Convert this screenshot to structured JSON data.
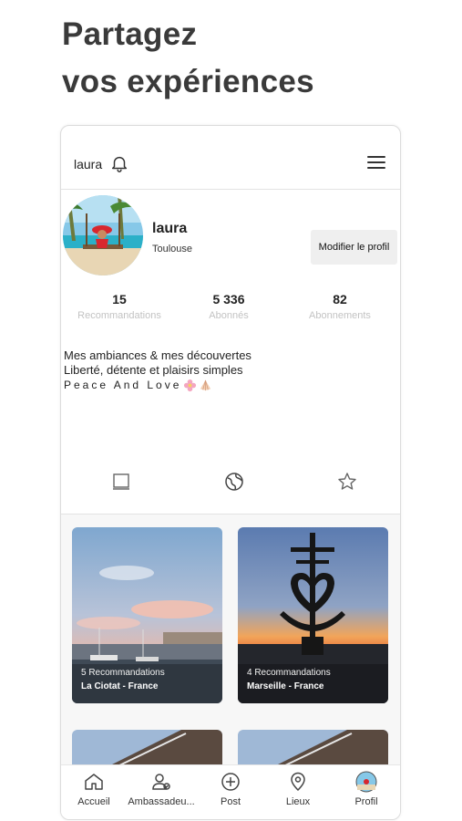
{
  "headline": {
    "line1": "Partagez",
    "line2": "vos expériences"
  },
  "topbar": {
    "username": "laura"
  },
  "profile": {
    "name": "laura",
    "city": "Toulouse",
    "edit_label": "Modifier le profil"
  },
  "stats": [
    {
      "value": "15",
      "label": "Recommandations"
    },
    {
      "value": "5 336",
      "label": "Abonnés"
    },
    {
      "value": "82",
      "label": "Abonnements"
    }
  ],
  "bio": {
    "line1": "Mes ambiances & mes découvertes",
    "line2": "Liberté, détente et plaisirs simples",
    "line3": "Peace And Love"
  },
  "posts": [
    {
      "recommendations": "5 Recommandations",
      "location": "La Ciotat - France"
    },
    {
      "recommendations": "4 Recommandations",
      "location": "Marseille - France"
    }
  ],
  "nav": [
    {
      "label": "Accueil",
      "icon": "home-icon"
    },
    {
      "label": "Ambassadeu...",
      "icon": "ambassador-icon"
    },
    {
      "label": "Post",
      "icon": "plus-circle-icon"
    },
    {
      "label": "Lieux",
      "icon": "location-pin-icon"
    },
    {
      "label": "Profil",
      "icon": "avatar-icon"
    }
  ],
  "colors": {
    "stat_label": "#c3c3c3",
    "button_bg": "#efefef",
    "text": "#222222"
  }
}
